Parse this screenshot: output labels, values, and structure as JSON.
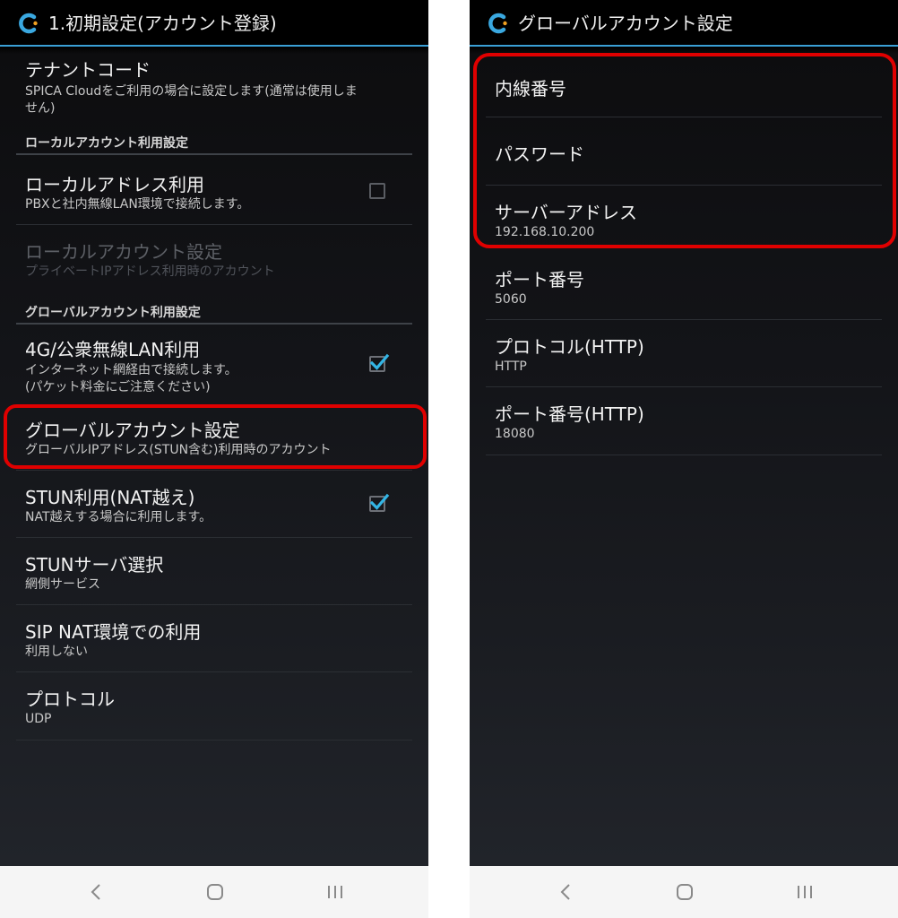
{
  "left": {
    "title": "1.初期設定(アカウント登録)",
    "tenant": {
      "title": "テナントコード",
      "summary_line1": "SPICA Cloudをご利用の場合に設定します(通常は使用しま",
      "summary_line2": "せん)"
    },
    "local_category": "ローカルアカウント利用設定",
    "local_address": {
      "title": "ローカルアドレス利用",
      "summary": "PBXと社内無線LAN環境で接続します。"
    },
    "local_account": {
      "title": "ローカルアカウント設定",
      "summary": "プライベートIPアドレス利用時のアカウント"
    },
    "global_category": "グローバルアカウント利用設定",
    "wan": {
      "title": "4G/公衆無線LAN利用",
      "summary_line1": "インターネット網経由で接続します。",
      "summary_line2": "(パケット料金にご注意ください)"
    },
    "global_account": {
      "title": "グローバルアカウント設定",
      "summary": "グローバルIPアドレス(STUN含む)利用時のアカウント"
    },
    "stun": {
      "title": "STUN利用(NAT越え)",
      "summary": "NAT越えする場合に利用します。"
    },
    "stun_server": {
      "title": "STUNサーバ選択",
      "summary": "網側サービス"
    },
    "sip_nat": {
      "title": "SIP NAT環境での利用",
      "summary": "利用しない"
    },
    "protocol": {
      "title": "プロトコル",
      "summary": "UDP"
    }
  },
  "right": {
    "title": "グローバルアカウント設定",
    "extension": {
      "title": "内線番号"
    },
    "password": {
      "title": "パスワード"
    },
    "server": {
      "title": "サーバーアドレス",
      "summary": "192.168.10.200"
    },
    "port": {
      "title": "ポート番号",
      "summary": "5060"
    },
    "protocol_http": {
      "title": "プロトコル(HTTP)",
      "summary": "HTTP"
    },
    "port_http": {
      "title": "ポート番号(HTTP)",
      "summary": "18080"
    }
  },
  "colors": {
    "accent": "#3a9fd6",
    "highlight": "#e00000",
    "check": "#33b5e5"
  }
}
